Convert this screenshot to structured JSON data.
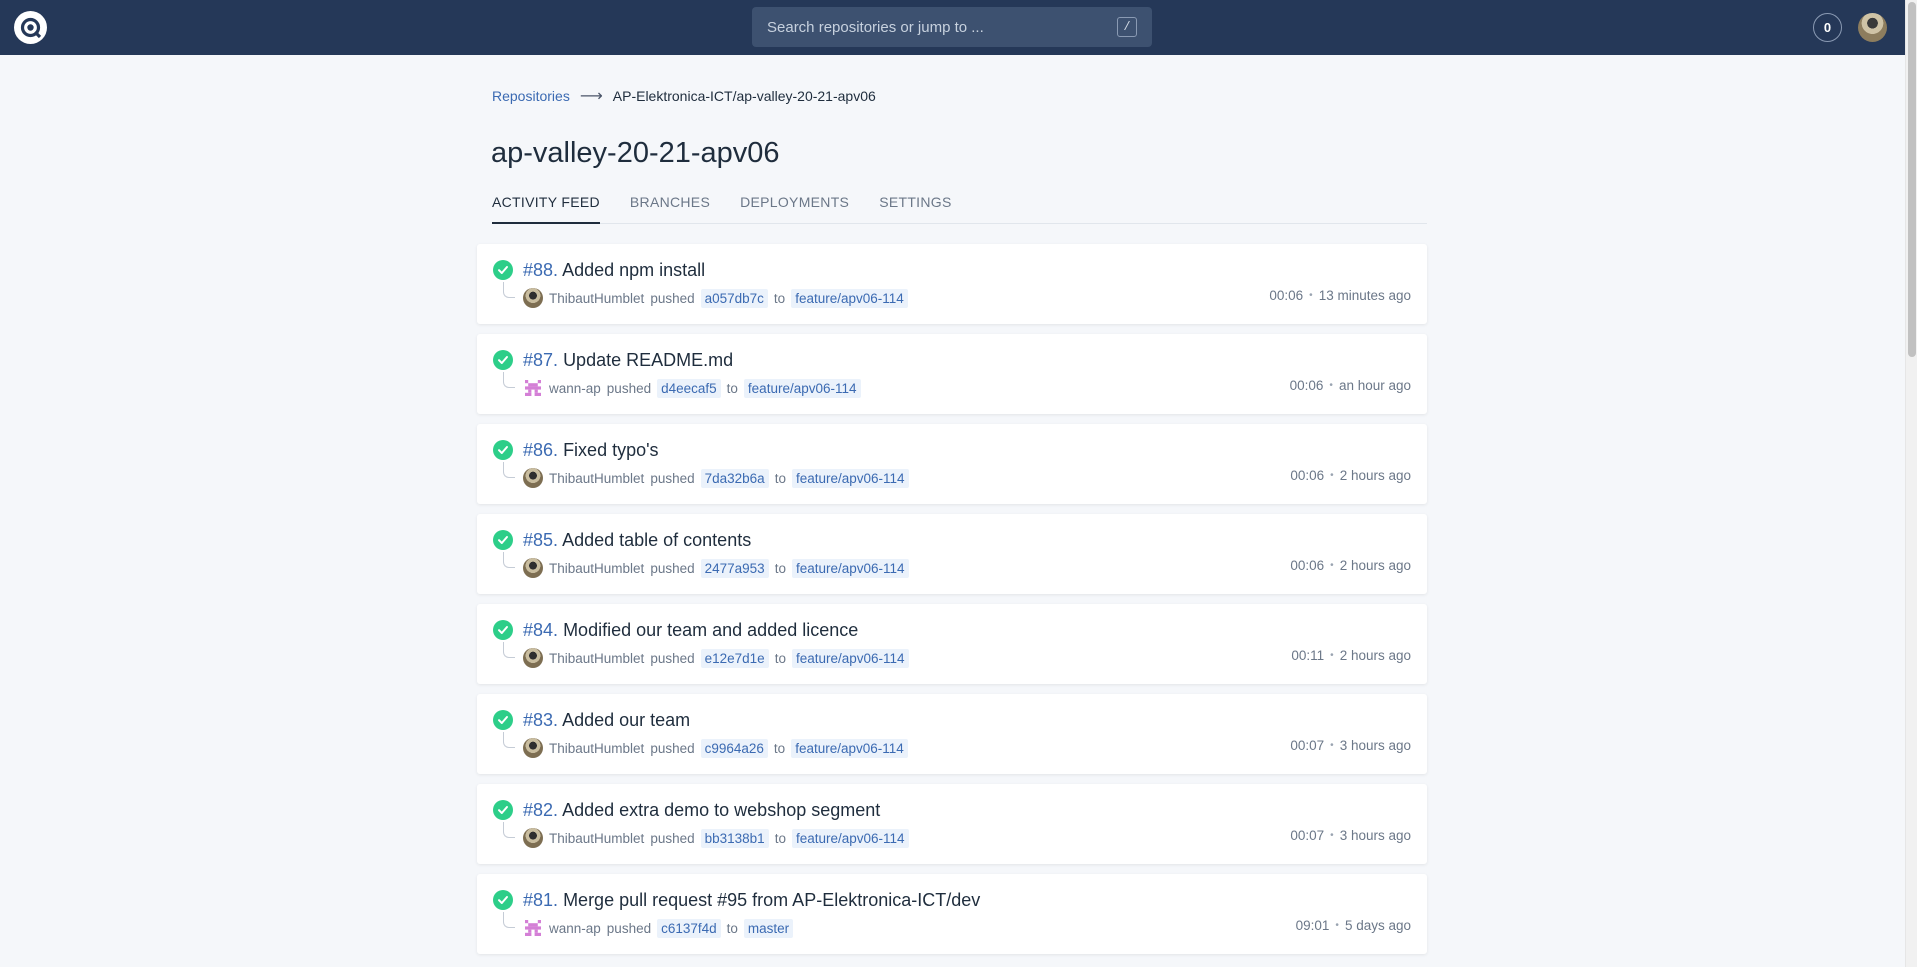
{
  "header": {
    "search_placeholder": "Search repositories or jump to ...",
    "search_shortcut": "/",
    "counter": "0"
  },
  "breadcrumb": {
    "root": "Repositories",
    "current": "AP-Elektronica-ICT/ap-valley-20-21-apv06"
  },
  "page": {
    "title": "ap-valley-20-21-apv06"
  },
  "tabs": [
    {
      "label": "ACTIVITY FEED"
    },
    {
      "label": "BRANCHES"
    },
    {
      "label": "DEPLOYMENTS"
    },
    {
      "label": "SETTINGS"
    }
  ],
  "feed": [
    {
      "number": "#88.",
      "message": "Added npm install",
      "user": "ThibautHumblet",
      "action": "pushed",
      "commit": "a057db7c",
      "to": "to",
      "branch": "feature/apv06-114",
      "duration": "00:06",
      "ago": "13 minutes ago",
      "avatar": "photo"
    },
    {
      "number": "#87.",
      "message": "Update README.md",
      "user": "wann-ap",
      "action": "pushed",
      "commit": "d4eecaf5",
      "to": "to",
      "branch": "feature/apv06-114",
      "duration": "00:06",
      "ago": "an hour ago",
      "avatar": "pixel"
    },
    {
      "number": "#86.",
      "message": "Fixed typo's",
      "user": "ThibautHumblet",
      "action": "pushed",
      "commit": "7da32b6a",
      "to": "to",
      "branch": "feature/apv06-114",
      "duration": "00:06",
      "ago": "2 hours ago",
      "avatar": "photo"
    },
    {
      "number": "#85.",
      "message": "Added table of contents",
      "user": "ThibautHumblet",
      "action": "pushed",
      "commit": "2477a953",
      "to": "to",
      "branch": "feature/apv06-114",
      "duration": "00:06",
      "ago": "2 hours ago",
      "avatar": "photo"
    },
    {
      "number": "#84.",
      "message": "Modified our team and added licence",
      "user": "ThibautHumblet",
      "action": "pushed",
      "commit": "e12e7d1e",
      "to": "to",
      "branch": "feature/apv06-114",
      "duration": "00:11",
      "ago": "2 hours ago",
      "avatar": "photo"
    },
    {
      "number": "#83.",
      "message": "Added our team",
      "user": "ThibautHumblet",
      "action": "pushed",
      "commit": "c9964a26",
      "to": "to",
      "branch": "feature/apv06-114",
      "duration": "00:07",
      "ago": "3 hours ago",
      "avatar": "photo"
    },
    {
      "number": "#82.",
      "message": "Added extra demo to webshop segment",
      "user": "ThibautHumblet",
      "action": "pushed",
      "commit": "bb3138b1",
      "to": "to",
      "branch": "feature/apv06-114",
      "duration": "00:07",
      "ago": "3 hours ago",
      "avatar": "photo"
    },
    {
      "number": "#81.",
      "message": "Merge pull request #95 from AP-Elektronica-ICT/dev",
      "user": "wann-ap",
      "action": "pushed",
      "commit": "c6137f4d",
      "to": "to",
      "branch": "master",
      "duration": "09:01",
      "ago": "5 days ago",
      "avatar": "pixel"
    }
  ],
  "colors": {
    "topbar": "#253858",
    "link": "#3b6ab2",
    "success": "#2dce89"
  }
}
